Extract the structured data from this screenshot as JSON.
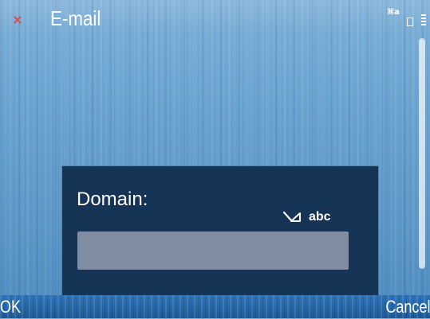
{
  "titlebar": {
    "title": "E-mail",
    "app_icon": "close-icon",
    "status": {
      "input_indicator": "⌘a",
      "battery_icon": "battery-icon",
      "signal_icon": "signal-icon"
    }
  },
  "scroll": {
    "position_fraction": 0.0,
    "visible_fraction": 1.0
  },
  "dialog": {
    "label": "Domain:",
    "input_mode": "abc",
    "input_mode_icon": "pen-icon",
    "field": {
      "value": "",
      "placeholder": ""
    }
  },
  "softkeys": {
    "left": "OK",
    "right": "Cancel"
  },
  "colors": {
    "dialog_bg": "#163456",
    "field_bg": "#808ca0",
    "accent_red": "#e04a4a",
    "softkey_bar": "#1e5a99"
  }
}
